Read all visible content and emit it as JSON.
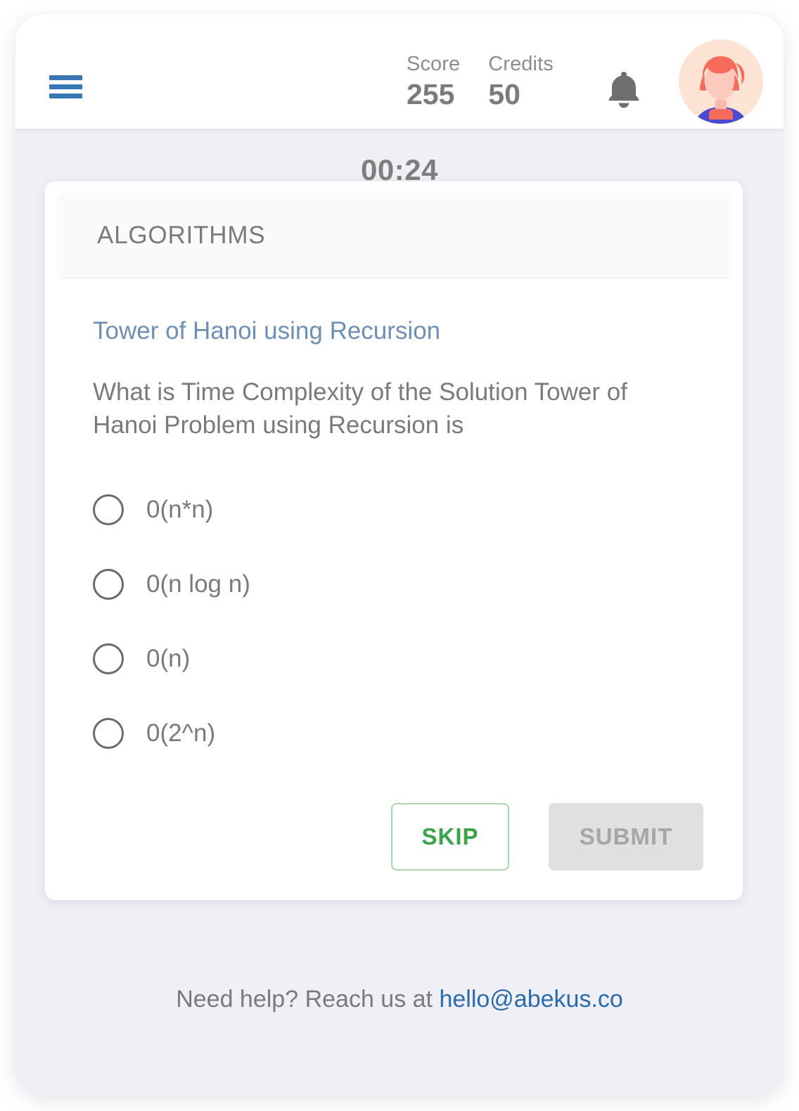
{
  "header": {
    "menu_icon": "hamburger-menu-icon",
    "score": {
      "label": "Score",
      "value": "255"
    },
    "credits": {
      "label": "Credits",
      "value": "50"
    },
    "notification_icon": "bell-icon",
    "avatar_icon": "user-avatar",
    "menu_color": "#3775b3"
  },
  "timer": {
    "value": "00:24"
  },
  "quiz": {
    "topic": "ALGORITHMS",
    "question_title": "Tower of Hanoi using Recursion",
    "question_text": "What is Time Complexity of the Solution Tower of Hanoi Problem using Recursion is",
    "options": [
      {
        "label": "0(n*n)",
        "selected": false
      },
      {
        "label": "0(n log n)",
        "selected": false
      },
      {
        "label": "0(n)",
        "selected": false
      },
      {
        "label": "0(2^n)",
        "selected": false
      }
    ],
    "skip_label": "SKIP",
    "submit_label": "SUBMIT",
    "skip_color": "#3aa44a",
    "submit_disabled": true
  },
  "footer": {
    "text": "Need help? Reach us at ",
    "email": "hello@abekus.co",
    "link_color": "#2c6ab0"
  }
}
